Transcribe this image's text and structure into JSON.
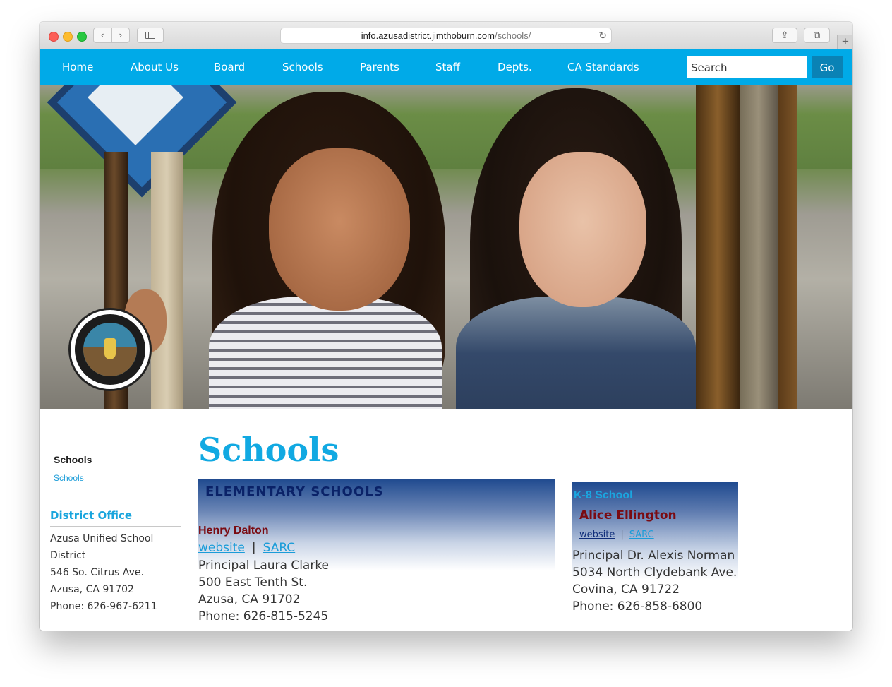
{
  "browser": {
    "url_host": "info.azusadistrict.jimthoburn.com",
    "url_path": "/schools/",
    "back_icon": "chevron-left",
    "forward_icon": "chevron-right",
    "reload_icon": "↻",
    "share_icon": "⇪",
    "tabs_icon": "⧉",
    "newtab_icon": "+"
  },
  "nav": {
    "items": [
      "Home",
      "About Us",
      "Board",
      "Schools",
      "Parents",
      "Staff",
      "Depts.",
      "CA Standards"
    ],
    "search_placeholder": "Search",
    "go_label": "Go",
    "bar_color": "#00aae8"
  },
  "sidebar": {
    "heading": "Schools",
    "link": "Schools",
    "office": {
      "heading": "District Office",
      "lines": [
        "Azusa Unified School",
        "District",
        "546 So. Citrus Ave.",
        "Azusa, CA  91702",
        "Phone:  626-967-6211"
      ]
    }
  },
  "main": {
    "title": "Schools",
    "elementary": {
      "heading": "ELEMENTARY SCHOOLS",
      "school": {
        "name": "Henry Dalton",
        "website_label": "website",
        "separator": "|",
        "sarc_label": "SARC",
        "lines": [
          "Principal Laura Clarke",
          "500 East Tenth St.",
          "Azusa, CA 91702",
          "Phone:  626-815-5245"
        ]
      }
    },
    "k8": {
      "heading": "K-8 School",
      "school": {
        "name": "Alice Ellington",
        "website_label": "website",
        "separator": "|",
        "sarc_label": "SARC",
        "lines": [
          "Principal Dr. Alexis Norman",
          "5034 North Clydebank Ave.",
          "Covina, CA  91722",
          "Phone:  626-858-6800"
        ]
      }
    }
  },
  "colors": {
    "accent": "#11a9e2",
    "school_name": "#7a0b12",
    "heading_navy": "#0a2268"
  }
}
